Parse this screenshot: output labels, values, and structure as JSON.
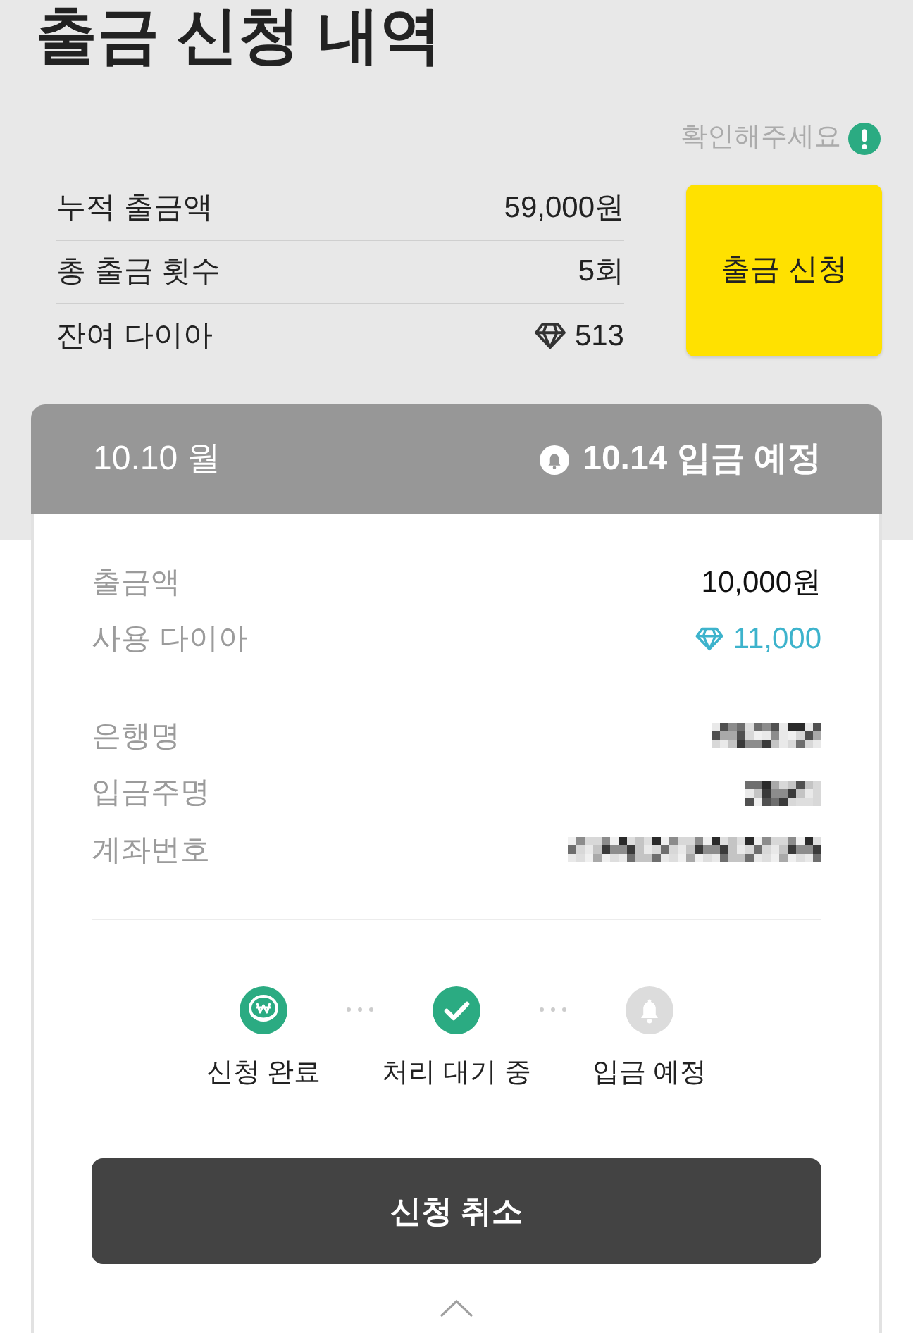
{
  "header": {
    "title": "출금 신청 내역"
  },
  "notice": {
    "text": "확인해주세요"
  },
  "summary": {
    "rows": [
      {
        "kind": "text",
        "label": "누적 출금액",
        "value": "59,000원"
      },
      {
        "kind": "text",
        "label": "총 출금 횟수",
        "value": "5회"
      },
      {
        "kind": "diamond",
        "label": "잔여 다이아",
        "value": "513"
      }
    ]
  },
  "apply_button": {
    "label": "출금 신청"
  },
  "request": {
    "date": "10.10 월",
    "expected": "10.14 입금 예정",
    "detail_groups": [
      {
        "rows": [
          {
            "kind": "amount",
            "label": "출금액",
            "value": "10,000원"
          },
          {
            "kind": "diamond",
            "label": "사용 다이아",
            "value": "11,000"
          }
        ]
      },
      {
        "rows": [
          {
            "kind": "redacted",
            "label": "은행명"
          },
          {
            "kind": "redacted",
            "label": "입금주명"
          },
          {
            "kind": "redacted",
            "label": "계좌번호"
          }
        ]
      }
    ],
    "steps": [
      {
        "kind": "coin",
        "label": "신청 완료",
        "done": true
      },
      {
        "kind": "check",
        "label": "처리 대기 중",
        "done": true
      },
      {
        "kind": "bell",
        "label": "입금 예정",
        "done": false
      }
    ],
    "cancel_button": {
      "label": "신청 취소"
    }
  }
}
